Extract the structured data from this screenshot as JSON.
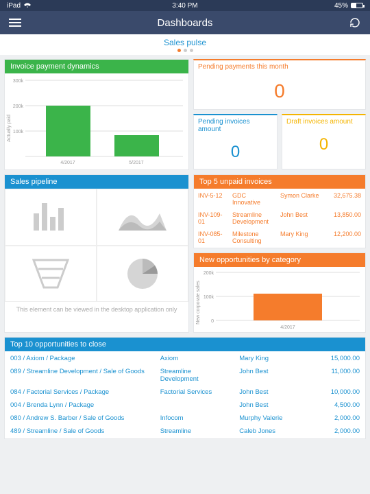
{
  "statusbar": {
    "device": "iPad",
    "time": "3:40 PM",
    "battery": "45%"
  },
  "navbar": {
    "title": "Dashboards"
  },
  "tab": {
    "label": "Sales pulse"
  },
  "cards": {
    "invoice_dynamics": {
      "title": "Invoice payment dynamics"
    },
    "pending_month": {
      "title": "Pending payments this month",
      "value": "0"
    },
    "pending_amount": {
      "title": "Pending invoices amount",
      "value": "0"
    },
    "draft_amount": {
      "title": "Draft invoices amount",
      "value": "0"
    },
    "sales_pipeline": {
      "title": "Sales pipeline",
      "note": "This element can be viewed in the desktop application only"
    },
    "top_unpaid": {
      "title": "Top 5 unpaid invoices",
      "rows": [
        {
          "no": "INV-5-12",
          "acct": "GDC Innovative",
          "owner": "Symon Clarke",
          "amt": "32,675.38"
        },
        {
          "no": "INV-109-01",
          "acct": "Streamline Development",
          "owner": "John Best",
          "amt": "13,850.00"
        },
        {
          "no": "INV-085-01",
          "acct": "Milestone Consulting",
          "owner": "Mary King",
          "amt": "12,200.00"
        }
      ]
    },
    "new_opps_cat": {
      "title": "New opportunities by category"
    },
    "top_opps": {
      "title": "Top 10 opportunities to close",
      "rows": [
        {
          "name": "003 / Axiom / Package",
          "acct": "Axiom",
          "owner": "Mary King",
          "amt": "15,000.00"
        },
        {
          "name": "089 / Streamline Development / Sale of Goods",
          "acct": "Streamline Development",
          "owner": "John Best",
          "amt": "11,000.00"
        },
        {
          "name": "084 / Factorial Services / Package",
          "acct": "Factorial Services",
          "owner": "John Best",
          "amt": "10,000.00"
        },
        {
          "name": "004 / Brenda Lynn / Package",
          "acct": "",
          "owner": "John Best",
          "amt": "4,500.00"
        },
        {
          "name": "080 / Andrew S. Barber / Sale of Goods",
          "acct": "Infocom",
          "owner": "Murphy Valerie",
          "amt": "2,000.00"
        },
        {
          "name": "489 / Streamline / Sale of Goods",
          "acct": "Streamline",
          "owner": "Caleb Jones",
          "amt": "2,000.00"
        }
      ]
    }
  },
  "chart_data": [
    {
      "type": "bar",
      "title": "Invoice payment dynamics",
      "ylabel": "Actually paid",
      "categories": [
        "4/2017",
        "5/2017"
      ],
      "values": [
        200000,
        85000
      ],
      "yticks": [
        "100k",
        "200k",
        "300k"
      ],
      "ylim": [
        0,
        300000
      ]
    },
    {
      "type": "bar",
      "title": "New opportunities by category",
      "ylabel": "New corporate sales",
      "categories": [
        "4/2017"
      ],
      "values": [
        110000
      ],
      "yticks": [
        "0",
        "100k",
        "200k"
      ],
      "ylim": [
        0,
        200000
      ]
    }
  ]
}
